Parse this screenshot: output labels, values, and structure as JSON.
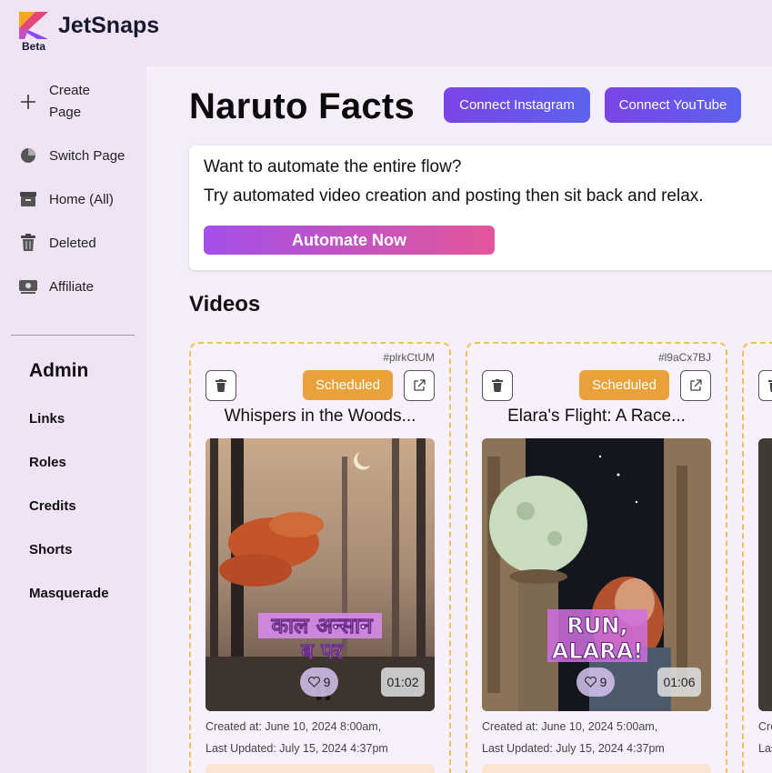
{
  "brand": {
    "name": "JetSnaps",
    "badge": "Beta",
    "logo_colors": [
      "#f5a623",
      "#e5467a",
      "#8a4cf0"
    ]
  },
  "sidebar": {
    "items": [
      {
        "label": "Create Page",
        "icon": "plus-icon"
      },
      {
        "label": "Switch Page",
        "icon": "pie-chart-icon"
      },
      {
        "label": "Home (All)",
        "icon": "archive-box-icon"
      },
      {
        "label": "Deleted",
        "icon": "trash-icon"
      },
      {
        "label": "Affiliate",
        "icon": "money-icon"
      }
    ],
    "admin": {
      "title": "Admin",
      "links": [
        "Links",
        "Roles",
        "Credits",
        "Shorts",
        "Masquerade"
      ]
    }
  },
  "header": {
    "title": "Naruto Facts",
    "connect_instagram": "Connect Instagram",
    "connect_youtube": "Connect YouTube"
  },
  "banner": {
    "line1": "Want to automate the entire flow?",
    "line2": "Try automated video creation and posting then sit back and relax.",
    "button": "Automate Now"
  },
  "videos": {
    "title": "Videos",
    "cards": [
      {
        "id": "#plrkCtUM",
        "status": "Scheduled",
        "title": "Whispers in the Woods...",
        "thumb_text_1": "काल अन्सान",
        "thumb_text_2": "ब पर",
        "likes": "9",
        "duration": "01:02",
        "created": "Created at: June 10, 2024 8:00am,",
        "updated": "Last Updated: July 15, 2024 4:37pm"
      },
      {
        "id": "#l9aCx7BJ",
        "status": "Scheduled",
        "title": "Elara's Flight: A Race...",
        "thumb_text_1": "RUN,",
        "thumb_text_2": "ALARA!",
        "likes": "9",
        "duration": "01:06",
        "created": "Created at: June 10, 2024 5:00am,",
        "updated": "Last Updated: July 15, 2024 4:37pm"
      },
      {
        "id": "",
        "status": "",
        "title": "",
        "created": "Cre",
        "updated": "Las"
      }
    ]
  },
  "colors": {
    "accent": "#7a43e8",
    "status_scheduled": "#e9a23b",
    "card_border": "#f0c05a"
  }
}
